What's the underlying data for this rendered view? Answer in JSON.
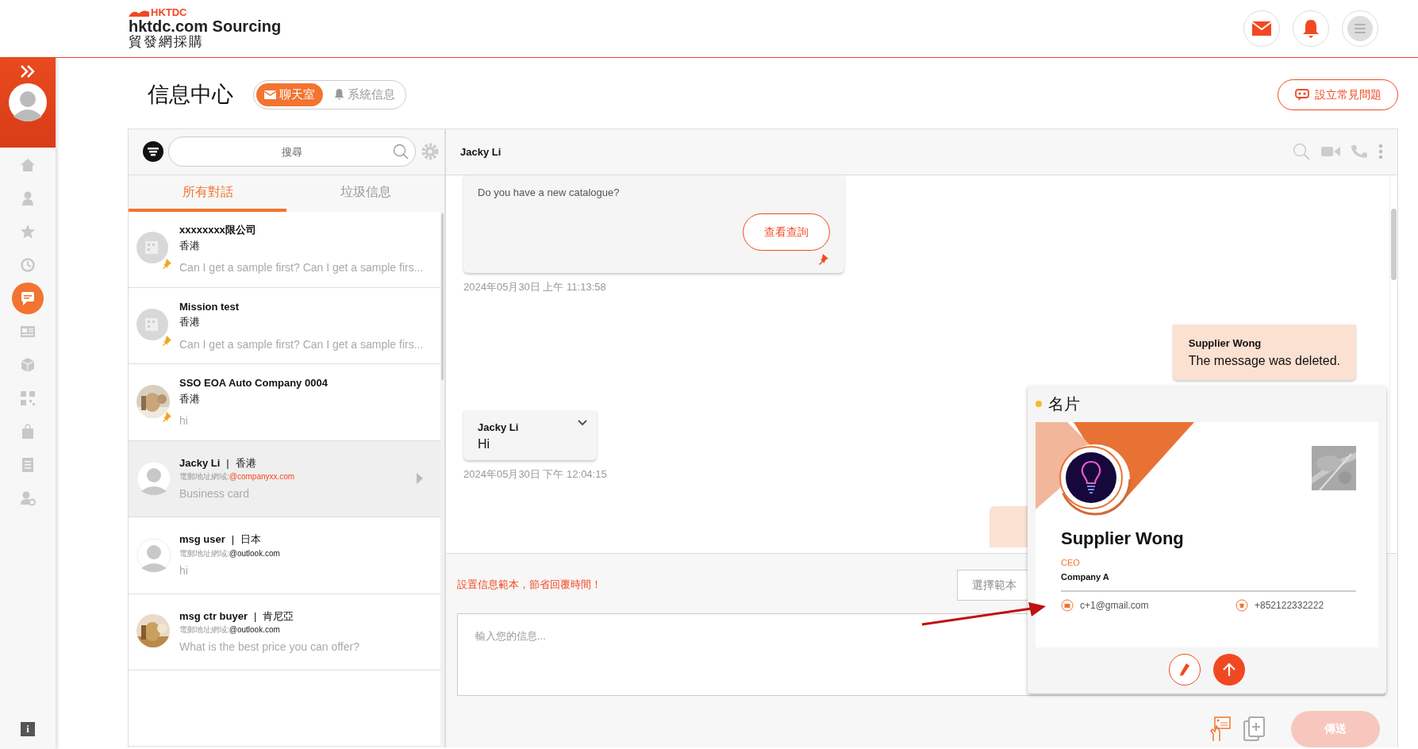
{
  "header": {
    "logo_mark": "HKTDC",
    "logo_title": "hktdc.com Sourcing",
    "logo_subtitle": "貿發網採購"
  },
  "sidebar": {
    "items": [
      {
        "kind": "home",
        "selected": false
      },
      {
        "kind": "person",
        "selected": false
      },
      {
        "kind": "star",
        "selected": false
      },
      {
        "kind": "history",
        "selected": false
      },
      {
        "kind": "chat",
        "selected": true
      },
      {
        "kind": "news",
        "selected": false
      },
      {
        "kind": "box",
        "selected": false
      },
      {
        "kind": "qr",
        "selected": false
      },
      {
        "kind": "bag",
        "selected": false
      },
      {
        "kind": "list",
        "selected": false
      },
      {
        "kind": "user-settings",
        "selected": false
      }
    ],
    "info": "i"
  },
  "page": {
    "title": "信息中心",
    "modes": [
      {
        "kind": "mail",
        "label": "聊天室",
        "selected": true
      },
      {
        "kind": "bell",
        "label": "系統信息",
        "selected": false
      }
    ],
    "faq_button": "設立常見問題"
  },
  "conversations": {
    "search": {
      "placeholder": "搜尋"
    },
    "tabs": [
      {
        "label": "所有對話",
        "selected": true
      },
      {
        "label": "垃圾信息",
        "selected": false
      }
    ],
    "items": [
      {
        "kind": "company",
        "avatar": {
          "kind": "building"
        },
        "name": "xxxxxxxx限公司",
        "region": "香港",
        "preview": "Can I get a sample first? Can I get a sample firs...",
        "pinned": true,
        "selected": false
      },
      {
        "kind": "company",
        "avatar": {
          "kind": "building"
        },
        "name": "Mission test",
        "region": "香港",
        "preview": "Can I get a sample first? Can I get a sample firs...",
        "pinned": true,
        "selected": false
      },
      {
        "kind": "company",
        "name": "SSO EOA Auto Company 0004",
        "region": "香港",
        "preview": "hi",
        "pinned": true,
        "selected": false
      },
      {
        "kind": "contact",
        "avatar": {
          "kind": "person"
        },
        "name": "Jacky Li",
        "separator": "|",
        "region": "香港",
        "domain_label": "電郵地址網域:",
        "domain": "@companyxx.com",
        "highlighted": true,
        "preview": "Business card",
        "pinned": false,
        "selected": true
      },
      {
        "kind": "contact",
        "avatar": {
          "kind": "person"
        },
        "name": "msg user",
        "separator": "|",
        "region": "日本",
        "domain_label": "電郵地址網域:",
        "domain": "@outlook.com",
        "highlighted": false,
        "preview": "hi",
        "pinned": false,
        "selected": false
      },
      {
        "kind": "contact",
        "name": "msg ctr buyer",
        "separator": "|",
        "region": "肯尼亞",
        "domain_label": "電郵地址網域:",
        "domain": "@outlook.com",
        "highlighted": false,
        "preview": "What is the best price you can offer?",
        "pinned": false,
        "selected": false
      }
    ]
  },
  "chat": {
    "title": "Jacky Li",
    "messages": [
      {
        "kind": "inquiry",
        "outgoing": false,
        "text": "Do you have a new catalogue?",
        "button": "查看查詢",
        "pinned": true,
        "time": "2024年05月30日 上午 11:13:58"
      },
      {
        "kind": "text",
        "outgoing": true,
        "sender": "Supplier Wong",
        "text": "The message was deleted."
      },
      {
        "kind": "text",
        "outgoing": false,
        "sender": "Jacky Li",
        "text": "Hi",
        "time": "2024年05月30日 下午 12:04:15"
      },
      {
        "kind": "card",
        "outgoing": true
      }
    ],
    "template_hint": "設置信息範本，節省回覆時間！",
    "template_button": "選擇範本",
    "input": {
      "placeholder": "輸入您的信息..."
    },
    "send_button": "傳送",
    "send_disabled": true
  },
  "business_card": {
    "title": "名片",
    "name": "Supplier Wong",
    "job_title": "CEO",
    "company": "Company A",
    "email": "c+1@gmail.com",
    "phone": "+852122332222"
  }
}
